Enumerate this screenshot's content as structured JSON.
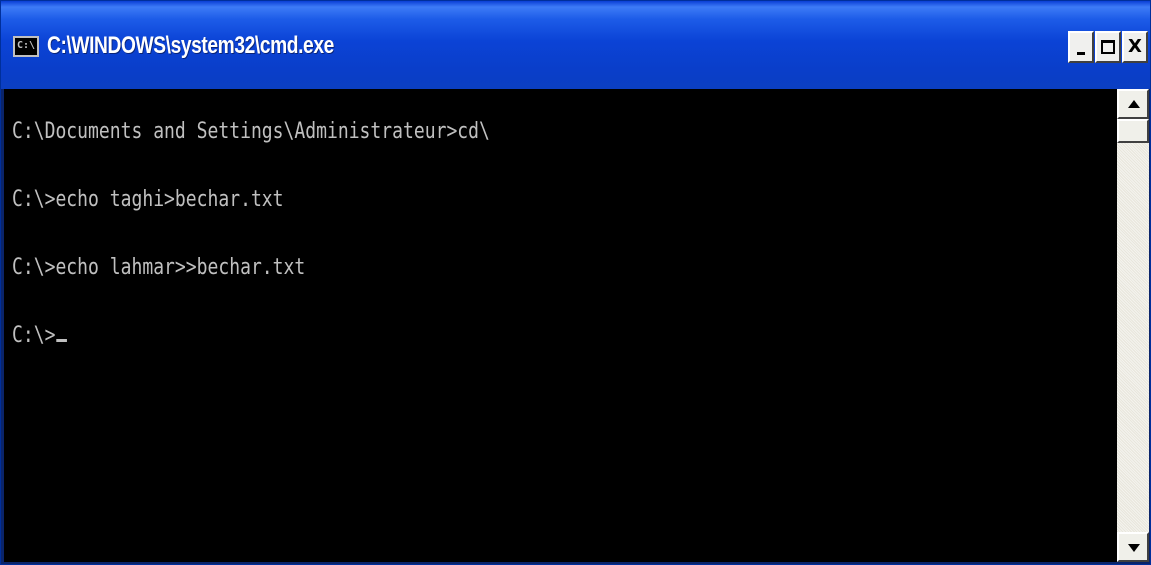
{
  "window": {
    "title": "C:\\WINDOWS\\system32\\cmd.exe",
    "icon_label": "C:\\",
    "controls": {
      "minimize_icon": "minimize-icon",
      "maximize_icon": "maximize-icon",
      "close_icon": "close-icon",
      "close_glyph": "X"
    }
  },
  "console": {
    "lines": [
      "C:\\Documents and Settings\\Administrateur>cd\\",
      "C:\\>echo taghi>bechar.txt",
      "C:\\>echo lahmar>>bechar.txt",
      "C:\\>"
    ],
    "colors": {
      "background": "#000000",
      "foreground": "#c0c0c0"
    }
  },
  "colors": {
    "titlebar": "#0b43d6",
    "title_text": "#ffffff"
  }
}
